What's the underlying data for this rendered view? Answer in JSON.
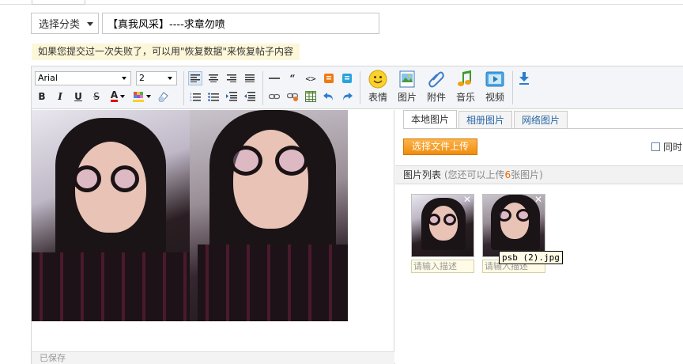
{
  "category_select": {
    "label": "选择分类"
  },
  "subject": {
    "value": "【真我风采】----求章勿喷"
  },
  "notice": {
    "text": "如果您提交过一次失败了，可以用\"恢复数据\"来恢复帖子内容"
  },
  "toolbar": {
    "font_family": "Arial",
    "font_size": "2",
    "emoji_label": "表情",
    "image_label": "图片",
    "attach_label": "附件",
    "music_label": "音乐",
    "video_label": "视频",
    "quote_glyph": "“",
    "code_glyph": "<>",
    "bold": "B",
    "italic": "I",
    "underline": "U",
    "strike": "S",
    "forecolor": "A"
  },
  "panel": {
    "tabs": [
      "本地图片",
      "相册图片",
      "网络图片"
    ],
    "upload_button": "选择文件上传",
    "checkbox_label": "同时",
    "list_title": "图片列表",
    "list_hint_pre": "(您还可以上传",
    "list_hint_num": "6",
    "list_hint_post": "张图片)",
    "thumbs": [
      {
        "desc_placeholder": "请输入描述"
      },
      {
        "desc_placeholder": "请输入描述"
      }
    ],
    "tooltip": "psb (2).jpg"
  },
  "editor": {
    "status_text": "已保存"
  },
  "colors": {
    "accent_orange": "#f08c0c",
    "link_blue": "#2865a6",
    "notice_bg": "#fdf7d9"
  },
  "icons": [
    "emoji-icon",
    "image-icon",
    "attach-icon",
    "music-icon",
    "video-icon",
    "download-icon"
  ]
}
